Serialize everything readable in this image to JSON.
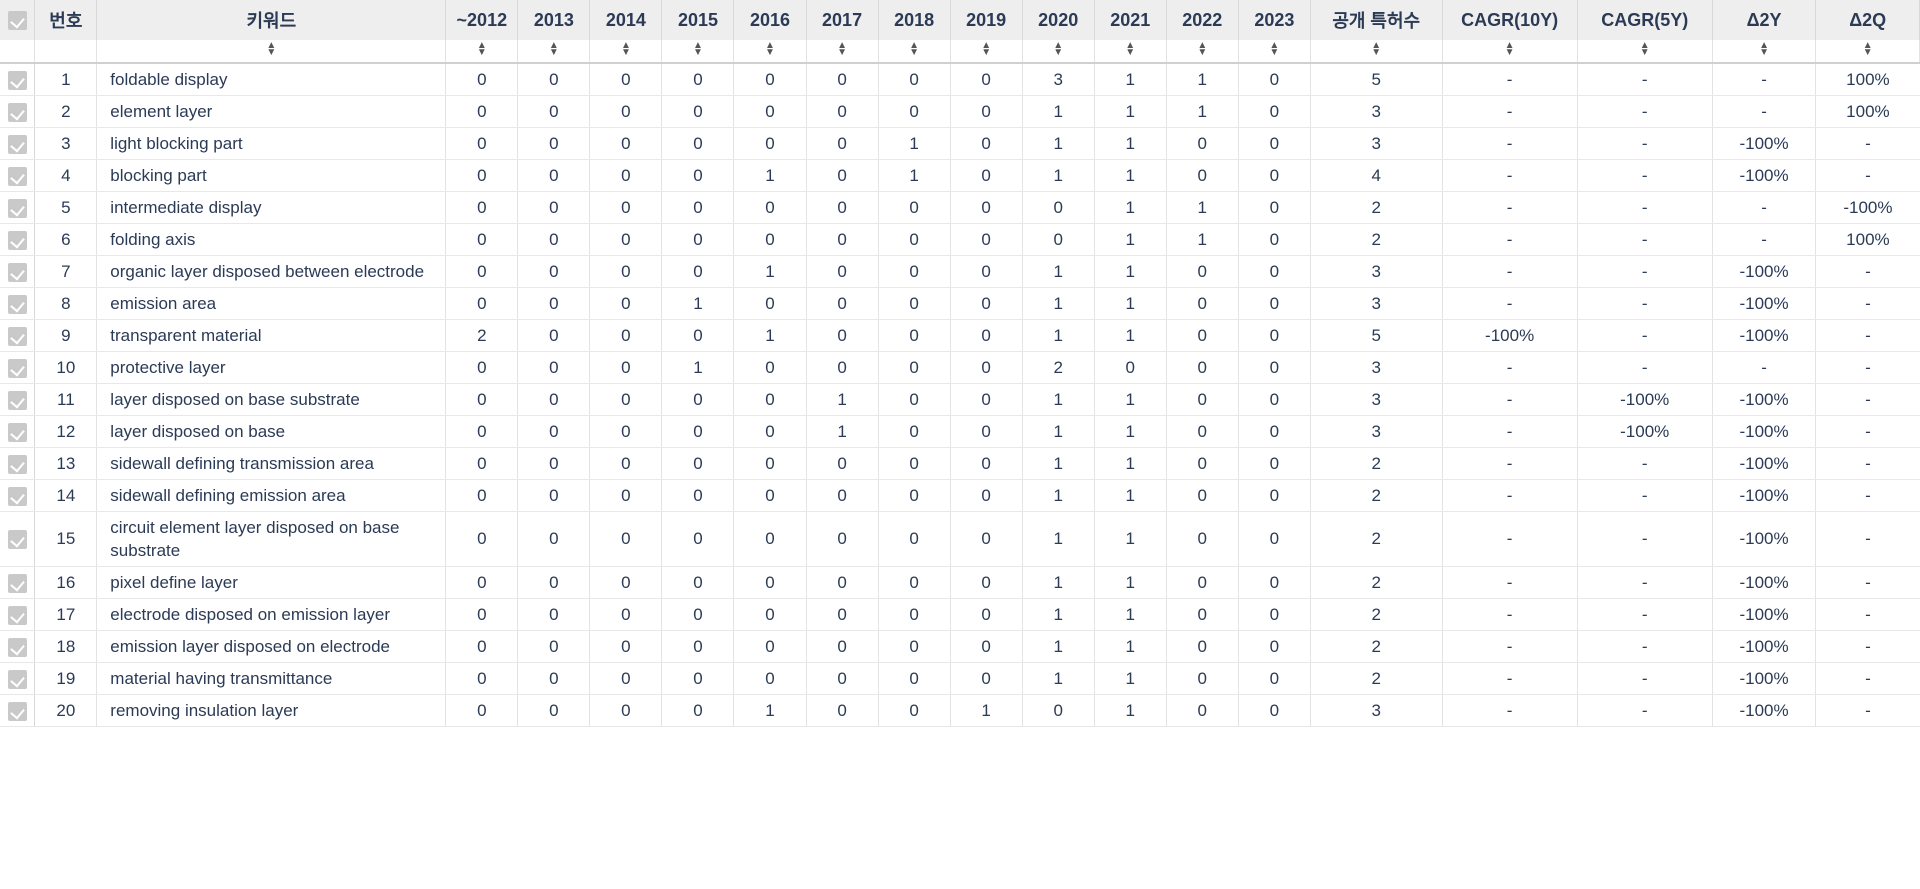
{
  "table": {
    "columns": [
      {
        "key": "checkbox",
        "label": "",
        "sortable": false
      },
      {
        "key": "no",
        "label": "번호",
        "sortable": false
      },
      {
        "key": "keyword",
        "label": "키워드",
        "sortable": true
      },
      {
        "key": "y2012",
        "label": "~2012",
        "sortable": true
      },
      {
        "key": "y2013",
        "label": "2013",
        "sortable": true
      },
      {
        "key": "y2014",
        "label": "2014",
        "sortable": true
      },
      {
        "key": "y2015",
        "label": "2015",
        "sortable": true
      },
      {
        "key": "y2016",
        "label": "2016",
        "sortable": true
      },
      {
        "key": "y2017",
        "label": "2017",
        "sortable": true
      },
      {
        "key": "y2018",
        "label": "2018",
        "sortable": true
      },
      {
        "key": "y2019",
        "label": "2019",
        "sortable": true
      },
      {
        "key": "y2020",
        "label": "2020",
        "sortable": true
      },
      {
        "key": "y2021",
        "label": "2021",
        "sortable": true
      },
      {
        "key": "y2022",
        "label": "2022",
        "sortable": true
      },
      {
        "key": "y2023",
        "label": "2023",
        "sortable": true
      },
      {
        "key": "total",
        "label": "공개 특허수",
        "sortable": true
      },
      {
        "key": "cagr10",
        "label": "CAGR(10Y)",
        "sortable": true
      },
      {
        "key": "cagr5",
        "label": "CAGR(5Y)",
        "sortable": true
      },
      {
        "key": "d2y",
        "label": "Δ2Y",
        "sortable": true
      },
      {
        "key": "d2q",
        "label": "Δ2Q",
        "sortable": true
      }
    ],
    "sort_icon": "sort-updown-icon",
    "checkbox_state": "checked",
    "rows": [
      {
        "no": "1",
        "keyword": "foldable display",
        "years": [
          "0",
          "0",
          "0",
          "0",
          "0",
          "0",
          "0",
          "0",
          "3",
          "1",
          "1",
          "0"
        ],
        "total": "5",
        "cagr10": "-",
        "cagr5": "-",
        "d2y": "-",
        "d2q": "100%"
      },
      {
        "no": "2",
        "keyword": "element layer",
        "years": [
          "0",
          "0",
          "0",
          "0",
          "0",
          "0",
          "0",
          "0",
          "1",
          "1",
          "1",
          "0"
        ],
        "total": "3",
        "cagr10": "-",
        "cagr5": "-",
        "d2y": "-",
        "d2q": "100%"
      },
      {
        "no": "3",
        "keyword": "light blocking part",
        "years": [
          "0",
          "0",
          "0",
          "0",
          "0",
          "0",
          "1",
          "0",
          "1",
          "1",
          "0",
          "0"
        ],
        "total": "3",
        "cagr10": "-",
        "cagr5": "-",
        "d2y": "-100%",
        "d2q": "-"
      },
      {
        "no": "4",
        "keyword": "blocking part",
        "years": [
          "0",
          "0",
          "0",
          "0",
          "1",
          "0",
          "1",
          "0",
          "1",
          "1",
          "0",
          "0"
        ],
        "total": "4",
        "cagr10": "-",
        "cagr5": "-",
        "d2y": "-100%",
        "d2q": "-"
      },
      {
        "no": "5",
        "keyword": "intermediate display",
        "years": [
          "0",
          "0",
          "0",
          "0",
          "0",
          "0",
          "0",
          "0",
          "0",
          "1",
          "1",
          "0"
        ],
        "total": "2",
        "cagr10": "-",
        "cagr5": "-",
        "d2y": "-",
        "d2q": "-100%"
      },
      {
        "no": "6",
        "keyword": "folding axis",
        "years": [
          "0",
          "0",
          "0",
          "0",
          "0",
          "0",
          "0",
          "0",
          "0",
          "1",
          "1",
          "0"
        ],
        "total": "2",
        "cagr10": "-",
        "cagr5": "-",
        "d2y": "-",
        "d2q": "100%"
      },
      {
        "no": "7",
        "keyword": "organic layer disposed between electrode",
        "years": [
          "0",
          "0",
          "0",
          "0",
          "1",
          "0",
          "0",
          "0",
          "1",
          "1",
          "0",
          "0"
        ],
        "total": "3",
        "cagr10": "-",
        "cagr5": "-",
        "d2y": "-100%",
        "d2q": "-"
      },
      {
        "no": "8",
        "keyword": "emission area",
        "years": [
          "0",
          "0",
          "0",
          "1",
          "0",
          "0",
          "0",
          "0",
          "1",
          "1",
          "0",
          "0"
        ],
        "total": "3",
        "cagr10": "-",
        "cagr5": "-",
        "d2y": "-100%",
        "d2q": "-"
      },
      {
        "no": "9",
        "keyword": "transparent material",
        "years": [
          "2",
          "0",
          "0",
          "0",
          "1",
          "0",
          "0",
          "0",
          "1",
          "1",
          "0",
          "0"
        ],
        "total": "5",
        "cagr10": "-100%",
        "cagr5": "-",
        "d2y": "-100%",
        "d2q": "-"
      },
      {
        "no": "10",
        "keyword": "protective layer",
        "years": [
          "0",
          "0",
          "0",
          "1",
          "0",
          "0",
          "0",
          "0",
          "2",
          "0",
          "0",
          "0"
        ],
        "total": "3",
        "cagr10": "-",
        "cagr5": "-",
        "d2y": "-",
        "d2q": "-"
      },
      {
        "no": "11",
        "keyword": "layer disposed on base substrate",
        "years": [
          "0",
          "0",
          "0",
          "0",
          "0",
          "1",
          "0",
          "0",
          "1",
          "1",
          "0",
          "0"
        ],
        "total": "3",
        "cagr10": "-",
        "cagr5": "-100%",
        "d2y": "-100%",
        "d2q": "-"
      },
      {
        "no": "12",
        "keyword": "layer disposed on base",
        "years": [
          "0",
          "0",
          "0",
          "0",
          "0",
          "1",
          "0",
          "0",
          "1",
          "1",
          "0",
          "0"
        ],
        "total": "3",
        "cagr10": "-",
        "cagr5": "-100%",
        "d2y": "-100%",
        "d2q": "-"
      },
      {
        "no": "13",
        "keyword": "sidewall defining transmission area",
        "years": [
          "0",
          "0",
          "0",
          "0",
          "0",
          "0",
          "0",
          "0",
          "1",
          "1",
          "0",
          "0"
        ],
        "total": "2",
        "cagr10": "-",
        "cagr5": "-",
        "d2y": "-100%",
        "d2q": "-"
      },
      {
        "no": "14",
        "keyword": "sidewall defining emission area",
        "years": [
          "0",
          "0",
          "0",
          "0",
          "0",
          "0",
          "0",
          "0",
          "1",
          "1",
          "0",
          "0"
        ],
        "total": "2",
        "cagr10": "-",
        "cagr5": "-",
        "d2y": "-100%",
        "d2q": "-"
      },
      {
        "no": "15",
        "keyword": "circuit element layer disposed on base substrate",
        "years": [
          "0",
          "0",
          "0",
          "0",
          "0",
          "0",
          "0",
          "0",
          "1",
          "1",
          "0",
          "0"
        ],
        "total": "2",
        "cagr10": "-",
        "cagr5": "-",
        "d2y": "-100%",
        "d2q": "-"
      },
      {
        "no": "16",
        "keyword": "pixel define layer",
        "years": [
          "0",
          "0",
          "0",
          "0",
          "0",
          "0",
          "0",
          "0",
          "1",
          "1",
          "0",
          "0"
        ],
        "total": "2",
        "cagr10": "-",
        "cagr5": "-",
        "d2y": "-100%",
        "d2q": "-"
      },
      {
        "no": "17",
        "keyword": "electrode disposed on emission layer",
        "years": [
          "0",
          "0",
          "0",
          "0",
          "0",
          "0",
          "0",
          "0",
          "1",
          "1",
          "0",
          "0"
        ],
        "total": "2",
        "cagr10": "-",
        "cagr5": "-",
        "d2y": "-100%",
        "d2q": "-"
      },
      {
        "no": "18",
        "keyword": "emission layer disposed on electrode",
        "years": [
          "0",
          "0",
          "0",
          "0",
          "0",
          "0",
          "0",
          "0",
          "1",
          "1",
          "0",
          "0"
        ],
        "total": "2",
        "cagr10": "-",
        "cagr5": "-",
        "d2y": "-100%",
        "d2q": "-"
      },
      {
        "no": "19",
        "keyword": "material having transmittance",
        "years": [
          "0",
          "0",
          "0",
          "0",
          "0",
          "0",
          "0",
          "0",
          "1",
          "1",
          "0",
          "0"
        ],
        "total": "2",
        "cagr10": "-",
        "cagr5": "-",
        "d2y": "-100%",
        "d2q": "-"
      },
      {
        "no": "20",
        "keyword": "removing insulation layer",
        "years": [
          "0",
          "0",
          "0",
          "0",
          "1",
          "0",
          "0",
          "1",
          "0",
          "1",
          "0",
          "0"
        ],
        "total": "3",
        "cagr10": "-",
        "cagr5": "-",
        "d2y": "-100%",
        "d2q": "-"
      }
    ]
  }
}
